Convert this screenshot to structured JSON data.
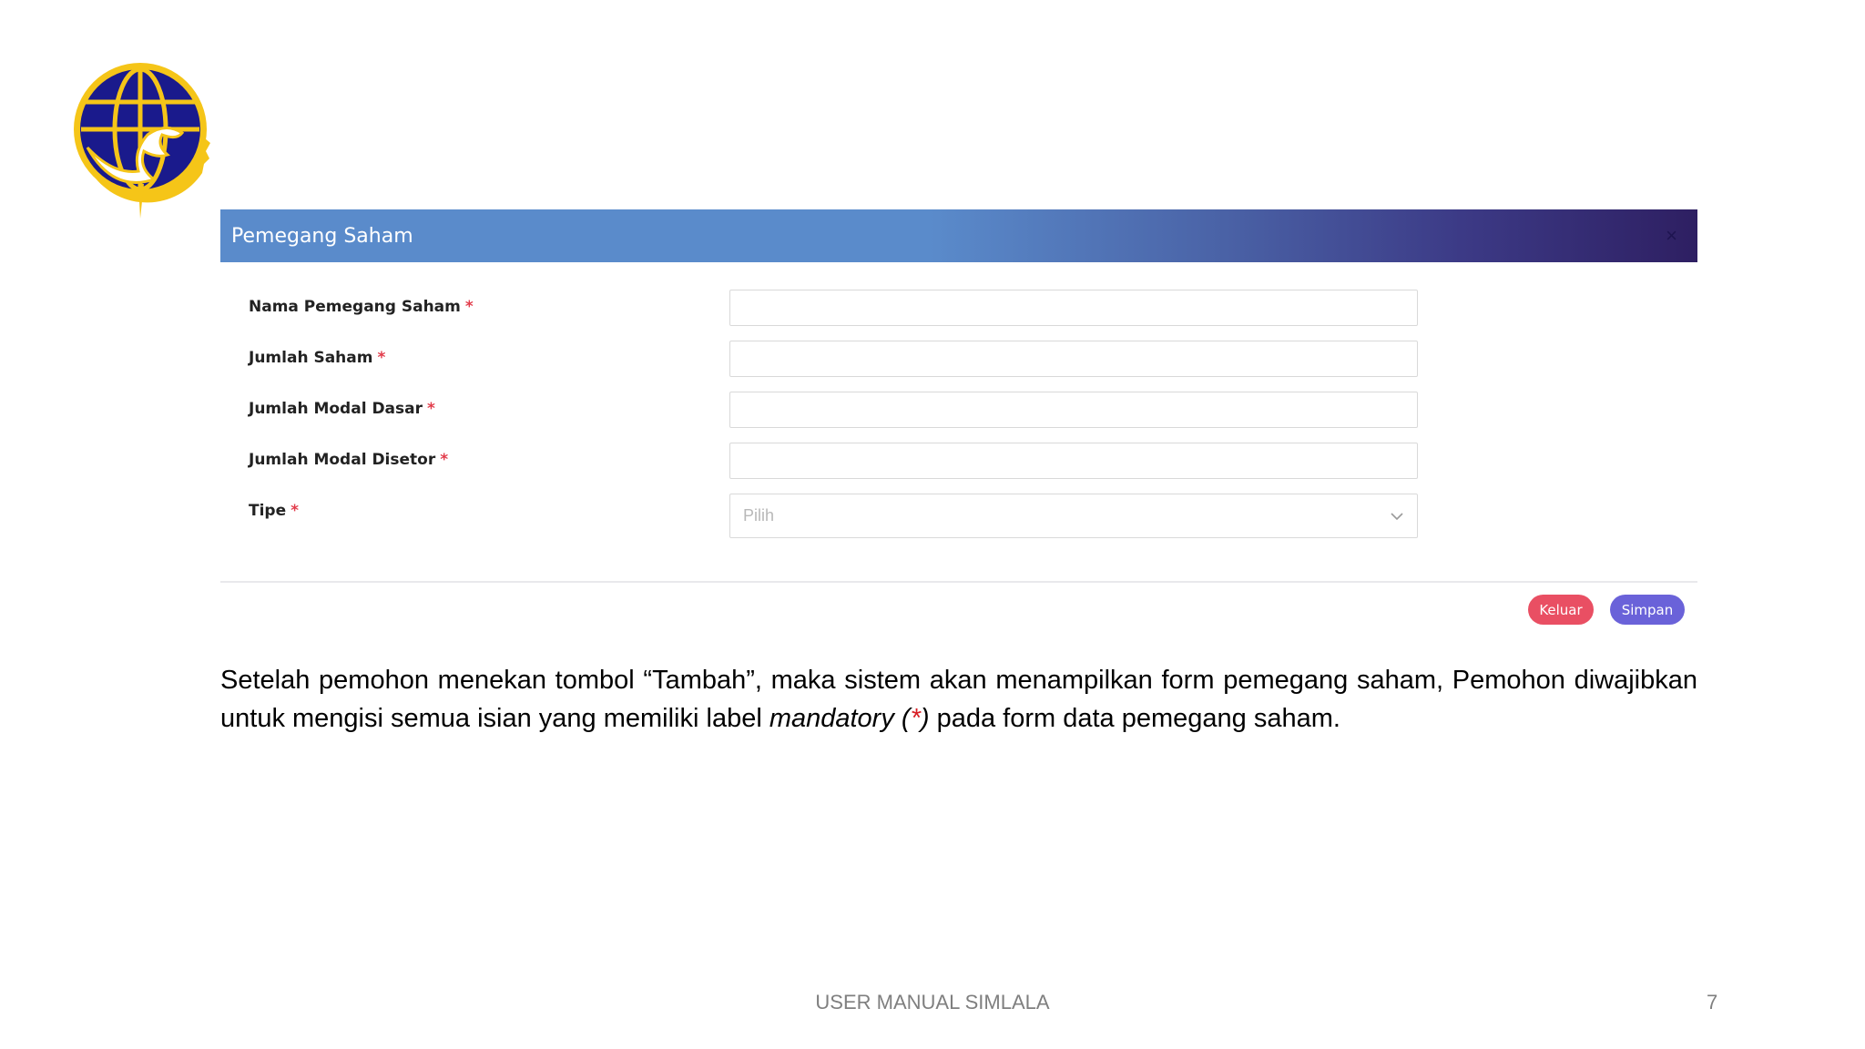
{
  "modal": {
    "title": "Pemegang Saham",
    "close_label": "×"
  },
  "form": {
    "required_marker": "*",
    "fields": [
      {
        "label": "Nama Pemegang Saham",
        "value": ""
      },
      {
        "label": "Jumlah Saham",
        "value": ""
      },
      {
        "label": "Jumlah Modal Dasar",
        "value": ""
      },
      {
        "label": "Jumlah Modal Disetor",
        "value": ""
      },
      {
        "label": "Tipe",
        "selected": "Pilih"
      }
    ]
  },
  "actions": {
    "keluar_label": "Keluar",
    "simpan_label": "Simpan"
  },
  "description": {
    "text_before": "Setelah pemohon menekan tombol “Tambah”, maka sistem akan menampilkan form pemegang saham, Pemohon diwajibkan untuk mengisi semua isian yang memiliki label ",
    "italic_word": "mandatory",
    "paren_open": "(",
    "asterisk": "*",
    "paren_close": ")",
    "text_after": " pada form data pemegang saham."
  },
  "footer": {
    "title": "USER MANUAL SIMLALA",
    "page_number": "7"
  },
  "colors": {
    "header_start": "#5a8bcb",
    "header_end": "#2e1f62",
    "required": "#e23c4b",
    "keluar": "#e94f63",
    "simpan": "#6a62d9"
  }
}
